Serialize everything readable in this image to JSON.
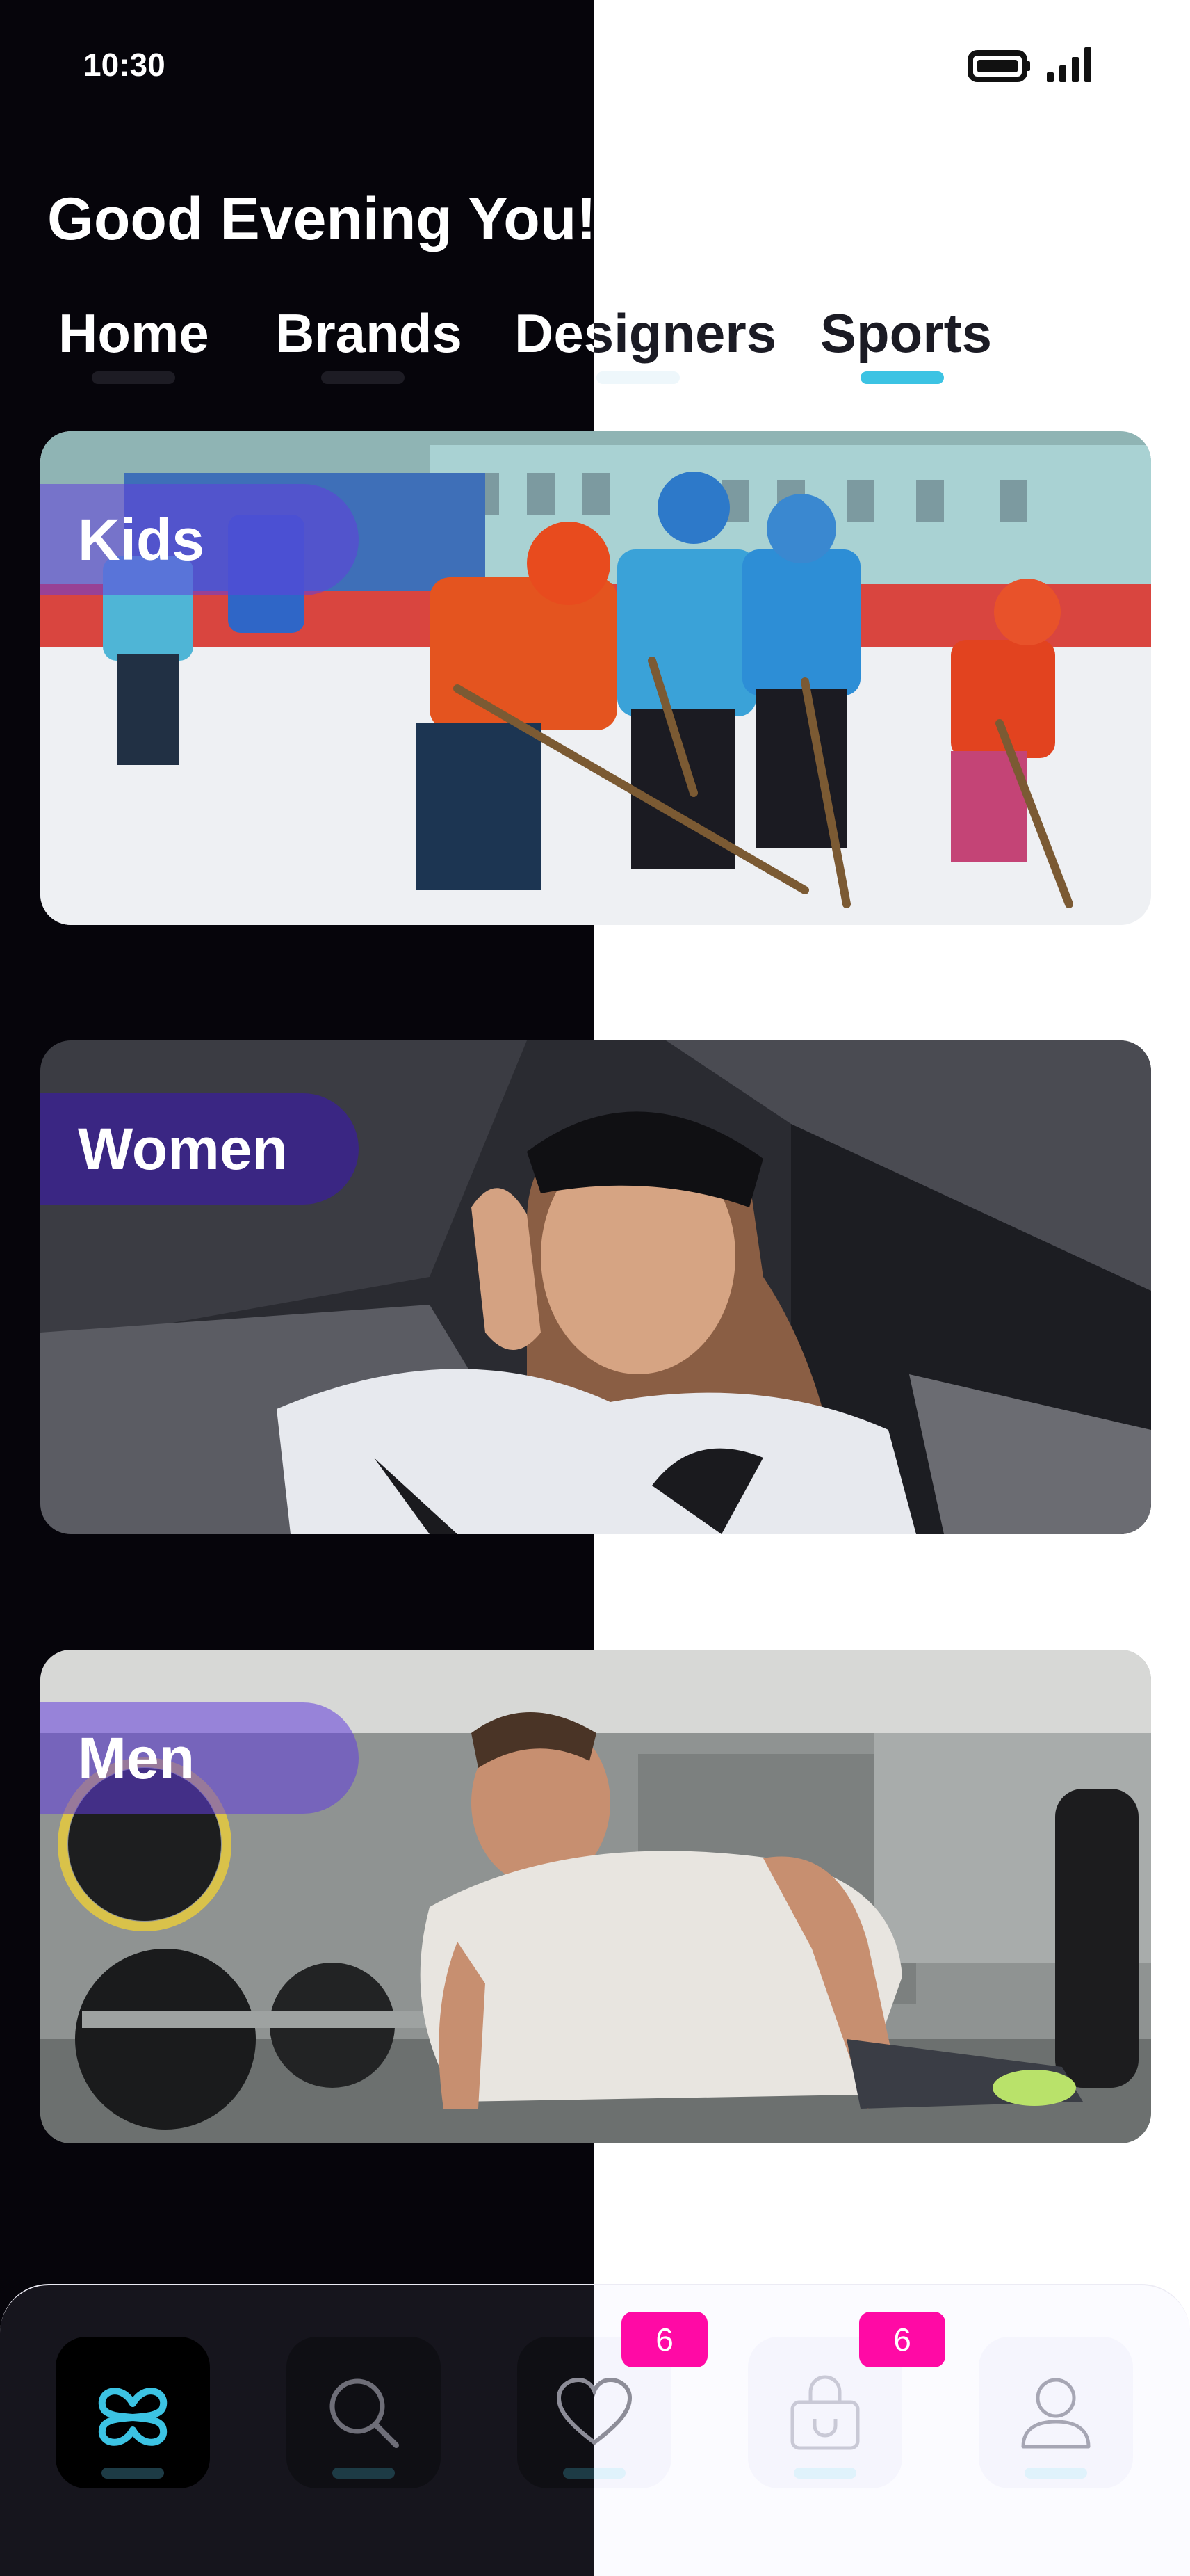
{
  "status_bar": {
    "time": "10:30"
  },
  "greeting": "Good Evening You!",
  "tabs": [
    {
      "label": "Home",
      "active": false
    },
    {
      "label": "Brands",
      "active": false
    },
    {
      "label": "Designers",
      "active": false
    },
    {
      "label": "Sports",
      "active": true
    }
  ],
  "categories": [
    {
      "label": "Kids"
    },
    {
      "label": "Women"
    },
    {
      "label": "Men"
    }
  ],
  "bottom_nav": {
    "items": [
      {
        "icon": "app-logo-icon",
        "active": true
      },
      {
        "icon": "search-icon",
        "active": false
      },
      {
        "icon": "heart-icon",
        "badge": "6"
      },
      {
        "icon": "shopping-bag-icon",
        "badge": "6"
      },
      {
        "icon": "profile-icon",
        "active": false
      }
    ]
  },
  "colors": {
    "accent": "#3cc3e3",
    "badge": "#ff0aa5",
    "label_background": "#3b2a9a",
    "dark_background": "#06050b"
  }
}
